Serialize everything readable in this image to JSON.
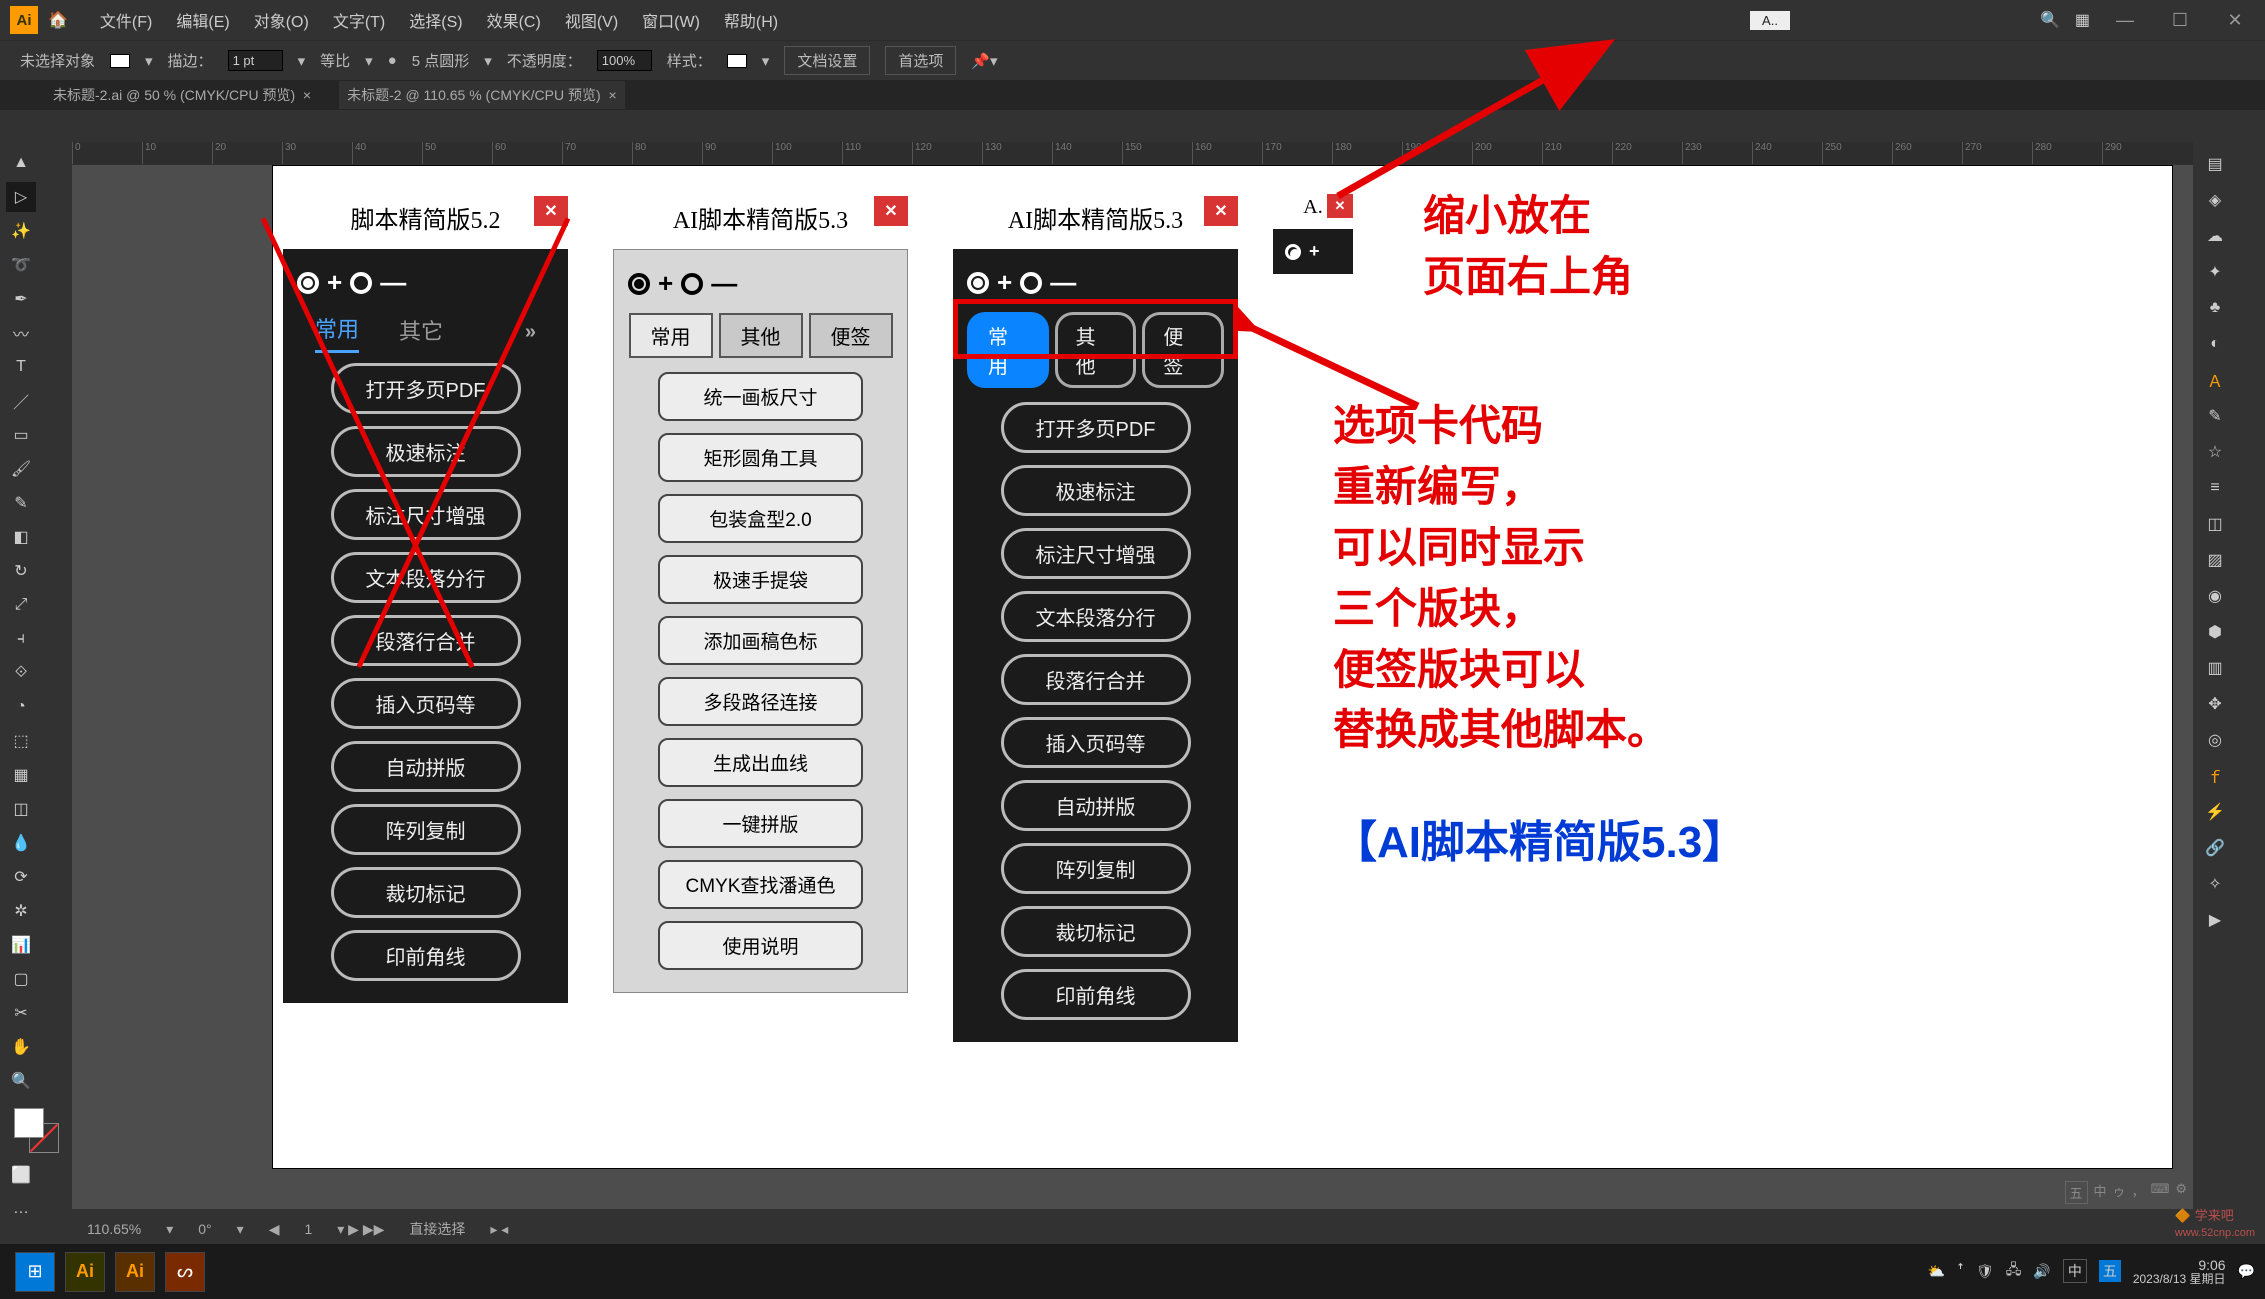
{
  "app": {
    "logo": "Ai"
  },
  "menu": [
    "文件(F)",
    "编辑(E)",
    "对象(O)",
    "文字(T)",
    "选择(S)",
    "效果(C)",
    "视图(V)",
    "窗口(W)",
    "帮助(H)"
  ],
  "mini_panel_top": "A..",
  "optbar": {
    "no_selection": "未选择对象",
    "stroke": "描边：",
    "stroke_val": "1 pt",
    "uniform": "等比",
    "points": "5 点圆形",
    "opacity": "不透明度：",
    "opacity_val": "100%",
    "style": "样式：",
    "doc_setup": "文档设置",
    "prefs": "首选项"
  },
  "tabs": [
    "未标题-2.ai @ 50 % (CMYK/CPU 预览)",
    "未标题-2 @ 110.65 % (CMYK/CPU 预览)"
  ],
  "panel1": {
    "title": "脚本精简版5.2",
    "tabs": [
      "常用",
      "其它"
    ],
    "buttons": [
      "打开多页PDF",
      "极速标注",
      "标注尺寸增强",
      "文本段落分行",
      "段落行合并",
      "插入页码等",
      "自动拼版",
      "阵列复制",
      "裁切标记",
      "印前角线"
    ]
  },
  "panel2": {
    "title": "AI脚本精简版5.3",
    "tabs": [
      "常用",
      "其他",
      "便签"
    ],
    "buttons": [
      "统一画板尺寸",
      "矩形圆角工具",
      "包装盒型2.0",
      "极速手提袋",
      "添加画稿色标",
      "多段路径连接",
      "生成出血线",
      "一键拼版",
      "CMYK查找潘通色",
      "使用说明"
    ]
  },
  "panel3": {
    "title": "AI脚本精简版5.3",
    "tabs": [
      "常用",
      "其他",
      "便签"
    ],
    "buttons": [
      "打开多页PDF",
      "极速标注",
      "标注尺寸增强",
      "文本段落分行",
      "段落行合并",
      "插入页码等",
      "自动拼版",
      "阵列复制",
      "裁切标记",
      "印前角线"
    ]
  },
  "panel4": {
    "title": "A."
  },
  "anno": {
    "top": "缩小放在\n页面右上角",
    "mid": "选项卡代码\n重新编写，\n可以同时显示\n三个版块，\n便签版块可以\n替换成其他脚本。",
    "bottom": "【AI脚本精简版5.3】"
  },
  "status": {
    "zoom": "110.65%",
    "rotate": "0°",
    "page": "1",
    "tool": "直接选择"
  },
  "tray": {
    "ime1": "五",
    "ime2": "中",
    "half": "ゥ",
    "punct": "，"
  },
  "taskbar": {
    "time": "9:06",
    "date": "2023/8/13",
    "day": "星期日"
  }
}
